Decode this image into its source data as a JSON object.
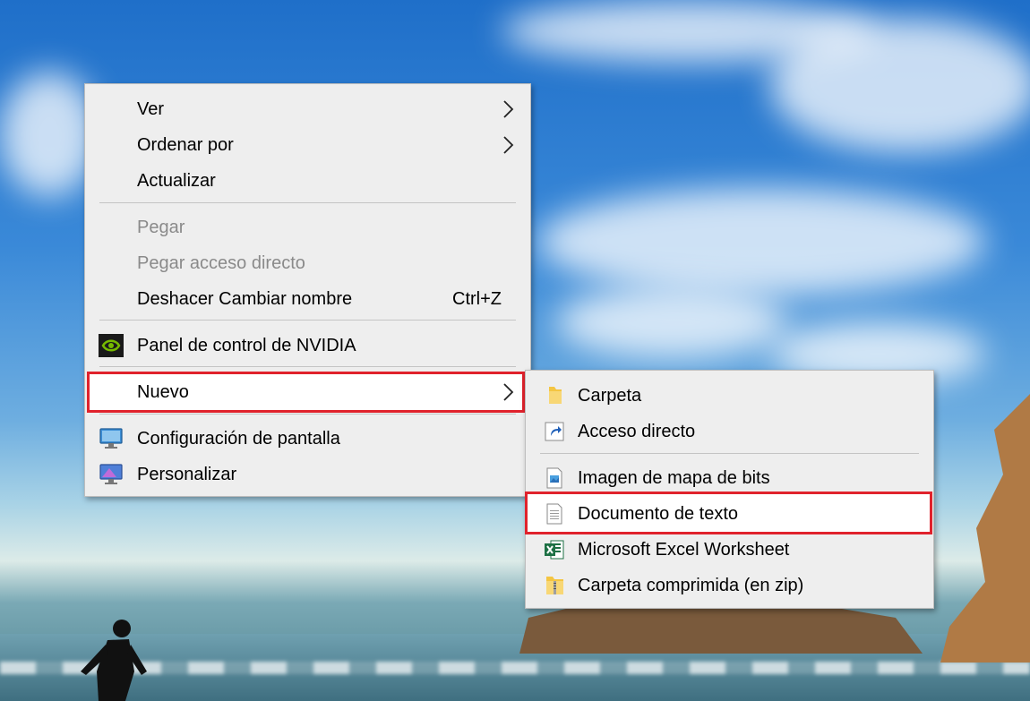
{
  "context_menu": {
    "items": [
      {
        "label": "Ver"
      },
      {
        "label": "Ordenar por"
      },
      {
        "label": "Actualizar"
      },
      {
        "label": "Pegar"
      },
      {
        "label": "Pegar acceso directo"
      },
      {
        "label": "Deshacer Cambiar nombre",
        "shortcut": "Ctrl+Z"
      },
      {
        "label": "Panel de control de NVIDIA"
      },
      {
        "label": "Nuevo"
      },
      {
        "label": "Configuración de pantalla"
      },
      {
        "label": "Personalizar"
      }
    ]
  },
  "submenu_nuevo": {
    "items": [
      {
        "label": "Carpeta"
      },
      {
        "label": "Acceso directo"
      },
      {
        "label": "Imagen de mapa de bits"
      },
      {
        "label": "Documento de texto"
      },
      {
        "label": "Microsoft Excel Worksheet"
      },
      {
        "label": "Carpeta comprimida (en zip)"
      }
    ]
  },
  "colors": {
    "menu_bg": "#eeeeee",
    "highlight_border": "#e0222c",
    "disabled_text": "#8a8a8a"
  },
  "icons": [
    "chevron-right-icon",
    "nvidia-icon",
    "display-settings-icon",
    "personalize-icon",
    "folder-icon",
    "shortcut-icon",
    "bitmap-icon",
    "text-document-icon",
    "excel-icon",
    "zip-folder-icon"
  ]
}
